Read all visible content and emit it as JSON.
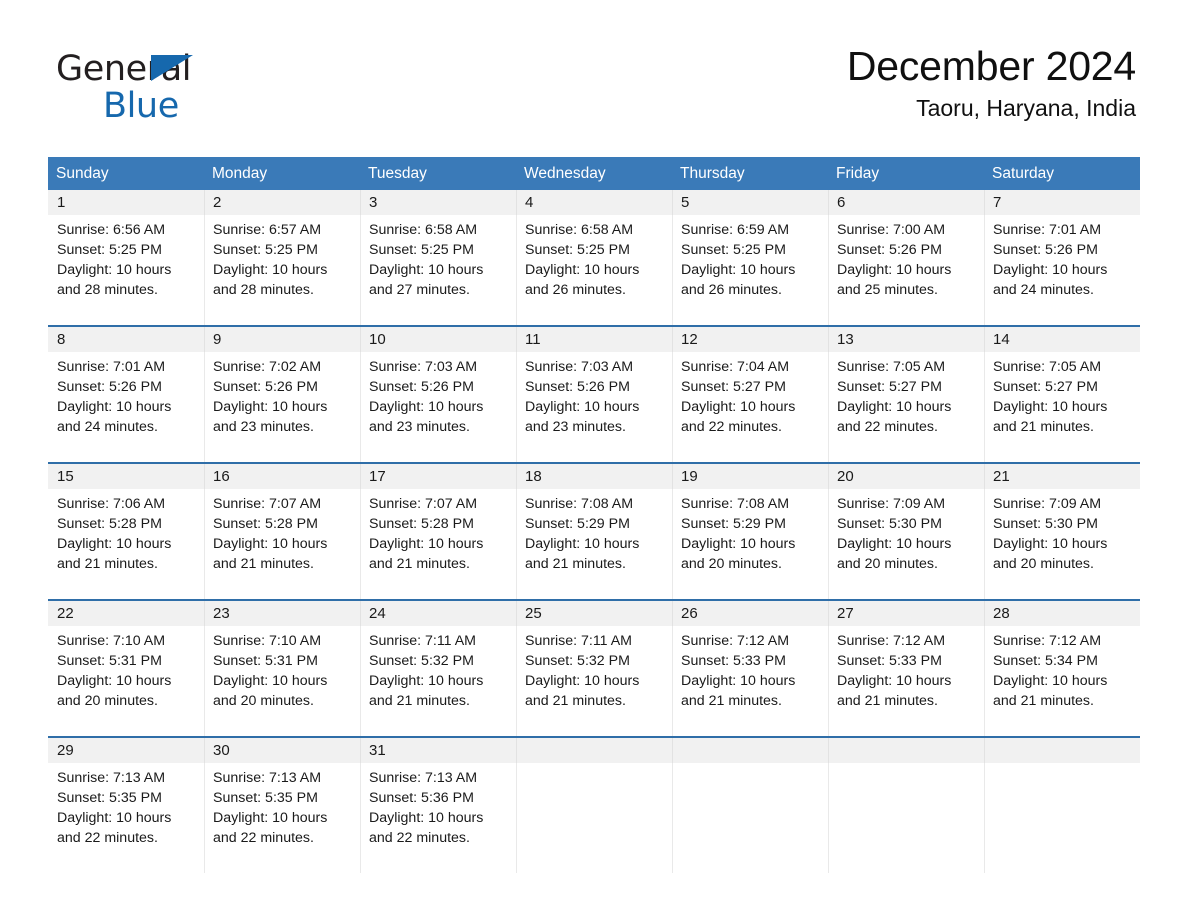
{
  "brand": {
    "name_part1": "General",
    "name_part2": "Blue",
    "accent_color": "#1668ad",
    "triangle_icon": "triangle-icon"
  },
  "header": {
    "title": "December 2024",
    "subtitle": "Taoru, Haryana, India"
  },
  "calendar": {
    "header_color": "#3a7ab8",
    "divider_color": "#2f6ea8",
    "daynum_band_color": "#f1f1f1",
    "weekday_labels": [
      "Sunday",
      "Monday",
      "Tuesday",
      "Wednesday",
      "Thursday",
      "Friday",
      "Saturday"
    ],
    "weeks": [
      [
        {
          "day": "1",
          "l1": "Sunrise: 6:56 AM",
          "l2": "Sunset: 5:25 PM",
          "l3": "Daylight: 10 hours",
          "l4": "and 28 minutes."
        },
        {
          "day": "2",
          "l1": "Sunrise: 6:57 AM",
          "l2": "Sunset: 5:25 PM",
          "l3": "Daylight: 10 hours",
          "l4": "and 28 minutes."
        },
        {
          "day": "3",
          "l1": "Sunrise: 6:58 AM",
          "l2": "Sunset: 5:25 PM",
          "l3": "Daylight: 10 hours",
          "l4": "and 27 minutes."
        },
        {
          "day": "4",
          "l1": "Sunrise: 6:58 AM",
          "l2": "Sunset: 5:25 PM",
          "l3": "Daylight: 10 hours",
          "l4": "and 26 minutes."
        },
        {
          "day": "5",
          "l1": "Sunrise: 6:59 AM",
          "l2": "Sunset: 5:25 PM",
          "l3": "Daylight: 10 hours",
          "l4": "and 26 minutes."
        },
        {
          "day": "6",
          "l1": "Sunrise: 7:00 AM",
          "l2": "Sunset: 5:26 PM",
          "l3": "Daylight: 10 hours",
          "l4": "and 25 minutes."
        },
        {
          "day": "7",
          "l1": "Sunrise: 7:01 AM",
          "l2": "Sunset: 5:26 PM",
          "l3": "Daylight: 10 hours",
          "l4": "and 24 minutes."
        }
      ],
      [
        {
          "day": "8",
          "l1": "Sunrise: 7:01 AM",
          "l2": "Sunset: 5:26 PM",
          "l3": "Daylight: 10 hours",
          "l4": "and 24 minutes."
        },
        {
          "day": "9",
          "l1": "Sunrise: 7:02 AM",
          "l2": "Sunset: 5:26 PM",
          "l3": "Daylight: 10 hours",
          "l4": "and 23 minutes."
        },
        {
          "day": "10",
          "l1": "Sunrise: 7:03 AM",
          "l2": "Sunset: 5:26 PM",
          "l3": "Daylight: 10 hours",
          "l4": "and 23 minutes."
        },
        {
          "day": "11",
          "l1": "Sunrise: 7:03 AM",
          "l2": "Sunset: 5:26 PM",
          "l3": "Daylight: 10 hours",
          "l4": "and 23 minutes."
        },
        {
          "day": "12",
          "l1": "Sunrise: 7:04 AM",
          "l2": "Sunset: 5:27 PM",
          "l3": "Daylight: 10 hours",
          "l4": "and 22 minutes."
        },
        {
          "day": "13",
          "l1": "Sunrise: 7:05 AM",
          "l2": "Sunset: 5:27 PM",
          "l3": "Daylight: 10 hours",
          "l4": "and 22 minutes."
        },
        {
          "day": "14",
          "l1": "Sunrise: 7:05 AM",
          "l2": "Sunset: 5:27 PM",
          "l3": "Daylight: 10 hours",
          "l4": "and 21 minutes."
        }
      ],
      [
        {
          "day": "15",
          "l1": "Sunrise: 7:06 AM",
          "l2": "Sunset: 5:28 PM",
          "l3": "Daylight: 10 hours",
          "l4": "and 21 minutes."
        },
        {
          "day": "16",
          "l1": "Sunrise: 7:07 AM",
          "l2": "Sunset: 5:28 PM",
          "l3": "Daylight: 10 hours",
          "l4": "and 21 minutes."
        },
        {
          "day": "17",
          "l1": "Sunrise: 7:07 AM",
          "l2": "Sunset: 5:28 PM",
          "l3": "Daylight: 10 hours",
          "l4": "and 21 minutes."
        },
        {
          "day": "18",
          "l1": "Sunrise: 7:08 AM",
          "l2": "Sunset: 5:29 PM",
          "l3": "Daylight: 10 hours",
          "l4": "and 21 minutes."
        },
        {
          "day": "19",
          "l1": "Sunrise: 7:08 AM",
          "l2": "Sunset: 5:29 PM",
          "l3": "Daylight: 10 hours",
          "l4": "and 20 minutes."
        },
        {
          "day": "20",
          "l1": "Sunrise: 7:09 AM",
          "l2": "Sunset: 5:30 PM",
          "l3": "Daylight: 10 hours",
          "l4": "and 20 minutes."
        },
        {
          "day": "21",
          "l1": "Sunrise: 7:09 AM",
          "l2": "Sunset: 5:30 PM",
          "l3": "Daylight: 10 hours",
          "l4": "and 20 minutes."
        }
      ],
      [
        {
          "day": "22",
          "l1": "Sunrise: 7:10 AM",
          "l2": "Sunset: 5:31 PM",
          "l3": "Daylight: 10 hours",
          "l4": "and 20 minutes."
        },
        {
          "day": "23",
          "l1": "Sunrise: 7:10 AM",
          "l2": "Sunset: 5:31 PM",
          "l3": "Daylight: 10 hours",
          "l4": "and 20 minutes."
        },
        {
          "day": "24",
          "l1": "Sunrise: 7:11 AM",
          "l2": "Sunset: 5:32 PM",
          "l3": "Daylight: 10 hours",
          "l4": "and 21 minutes."
        },
        {
          "day": "25",
          "l1": "Sunrise: 7:11 AM",
          "l2": "Sunset: 5:32 PM",
          "l3": "Daylight: 10 hours",
          "l4": "and 21 minutes."
        },
        {
          "day": "26",
          "l1": "Sunrise: 7:12 AM",
          "l2": "Sunset: 5:33 PM",
          "l3": "Daylight: 10 hours",
          "l4": "and 21 minutes."
        },
        {
          "day": "27",
          "l1": "Sunrise: 7:12 AM",
          "l2": "Sunset: 5:33 PM",
          "l3": "Daylight: 10 hours",
          "l4": "and 21 minutes."
        },
        {
          "day": "28",
          "l1": "Sunrise: 7:12 AM",
          "l2": "Sunset: 5:34 PM",
          "l3": "Daylight: 10 hours",
          "l4": "and 21 minutes."
        }
      ],
      [
        {
          "day": "29",
          "l1": "Sunrise: 7:13 AM",
          "l2": "Sunset: 5:35 PM",
          "l3": "Daylight: 10 hours",
          "l4": "and 22 minutes."
        },
        {
          "day": "30",
          "l1": "Sunrise: 7:13 AM",
          "l2": "Sunset: 5:35 PM",
          "l3": "Daylight: 10 hours",
          "l4": "and 22 minutes."
        },
        {
          "day": "31",
          "l1": "Sunrise: 7:13 AM",
          "l2": "Sunset: 5:36 PM",
          "l3": "Daylight: 10 hours",
          "l4": "and 22 minutes."
        },
        {
          "day": "",
          "l1": "",
          "l2": "",
          "l3": "",
          "l4": ""
        },
        {
          "day": "",
          "l1": "",
          "l2": "",
          "l3": "",
          "l4": ""
        },
        {
          "day": "",
          "l1": "",
          "l2": "",
          "l3": "",
          "l4": ""
        },
        {
          "day": "",
          "l1": "",
          "l2": "",
          "l3": "",
          "l4": ""
        }
      ]
    ]
  }
}
